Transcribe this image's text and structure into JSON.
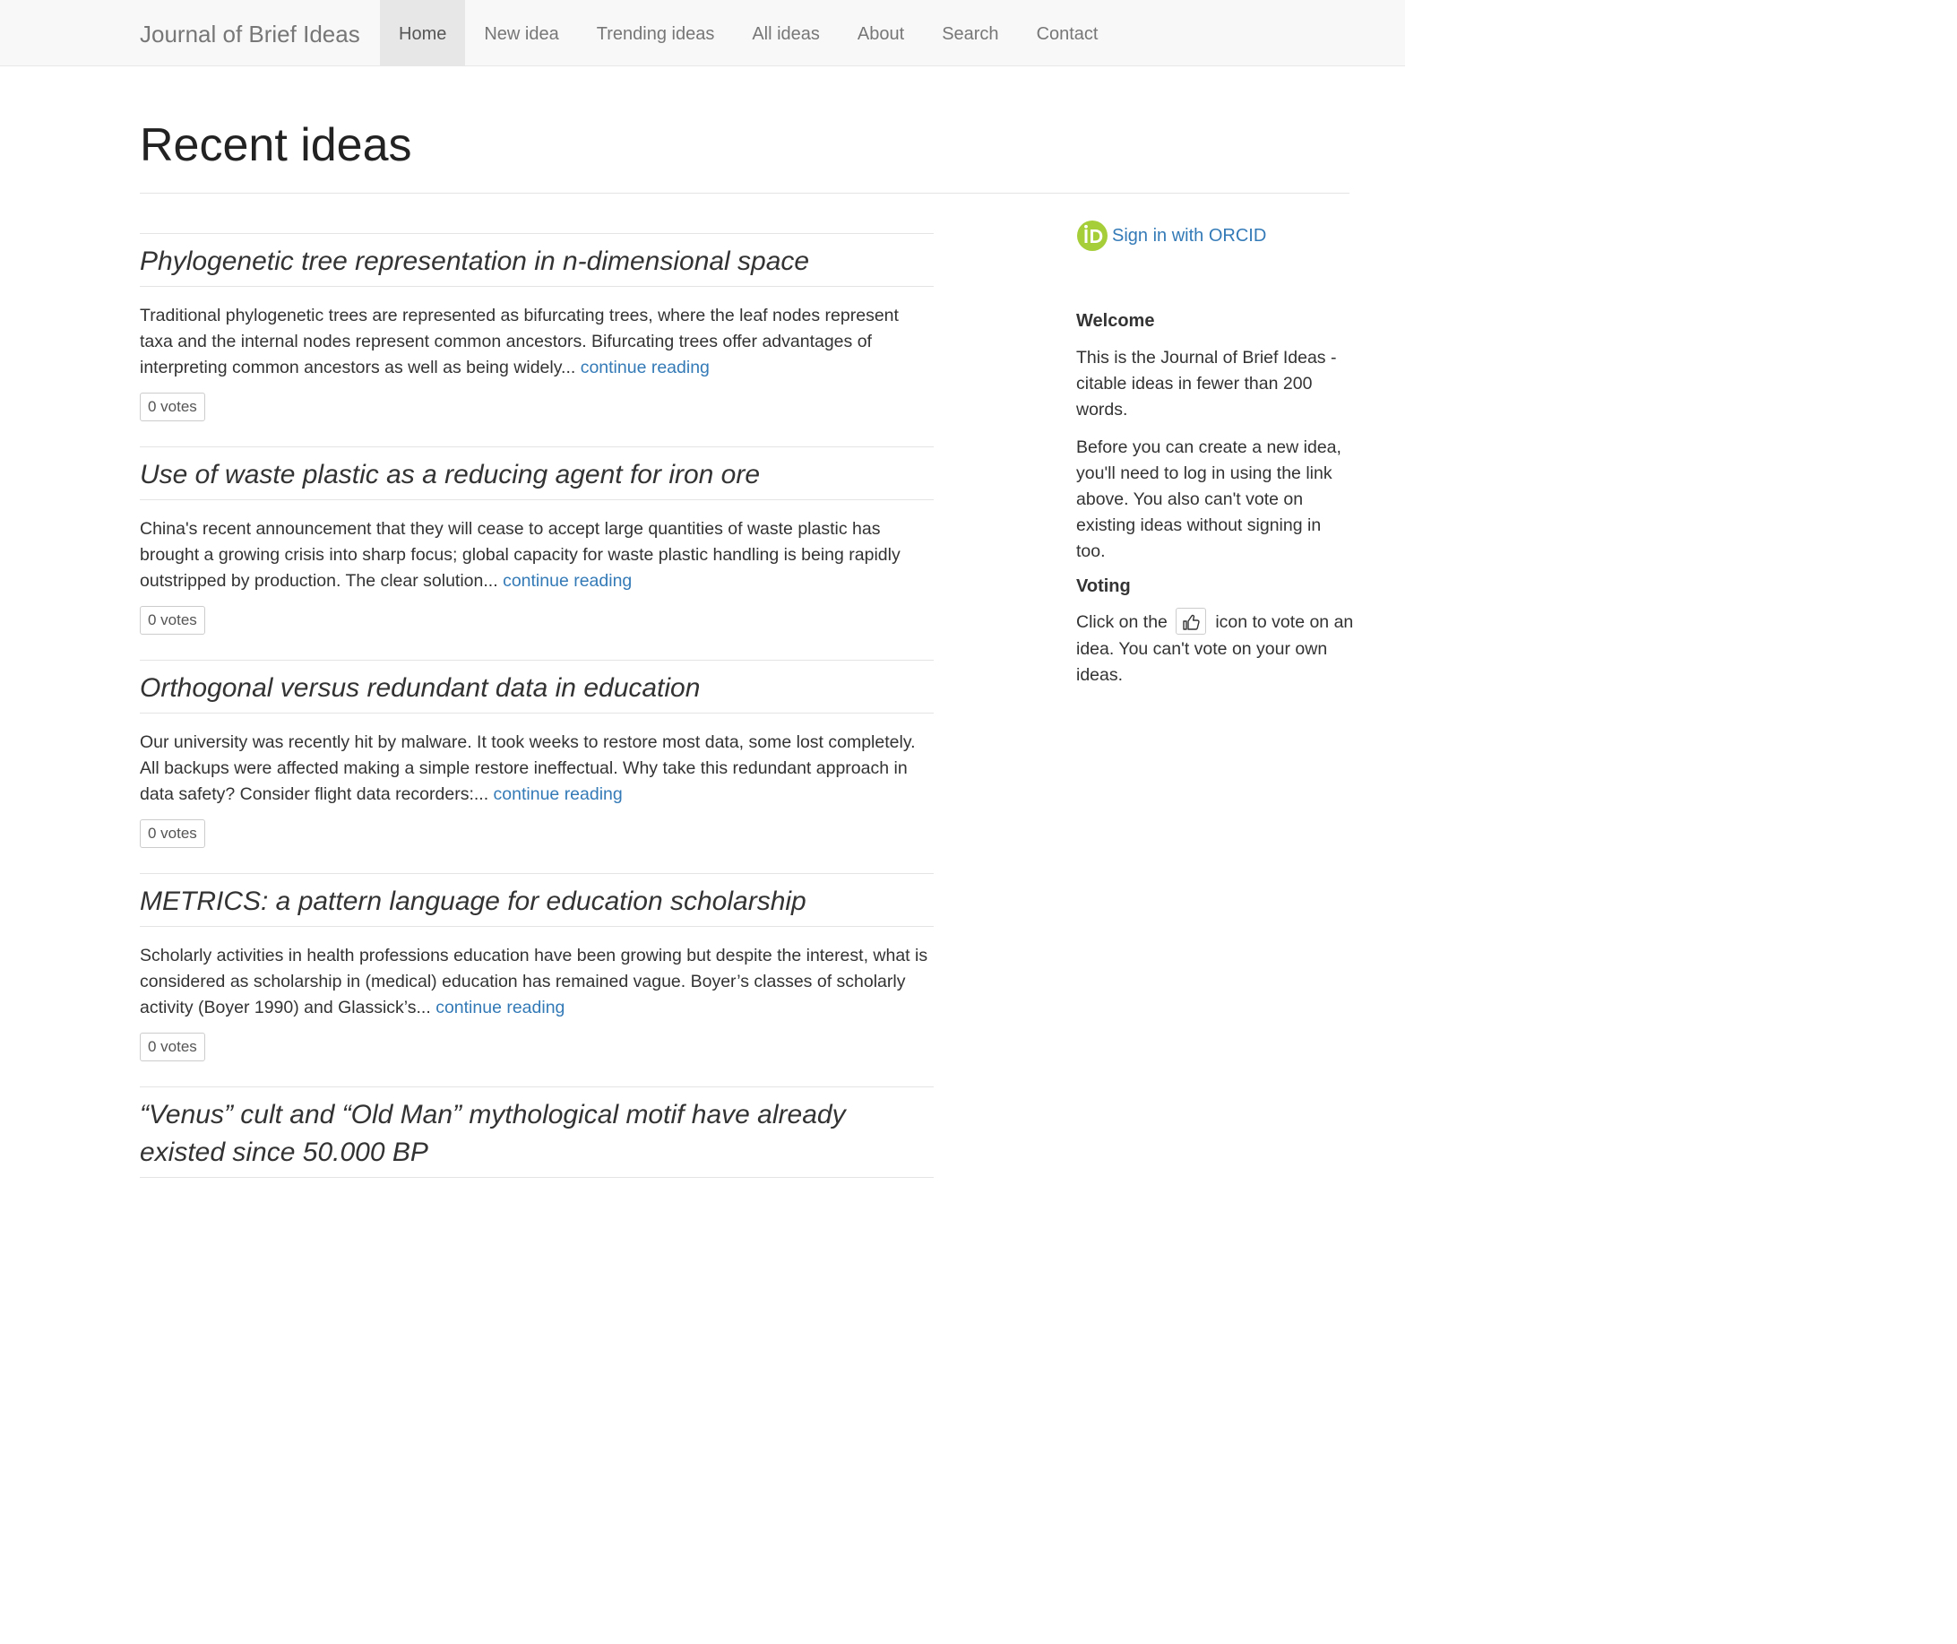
{
  "navbar": {
    "brand": "Journal of Brief Ideas",
    "items": [
      {
        "label": "Home",
        "active": true
      },
      {
        "label": "New idea",
        "active": false
      },
      {
        "label": "Trending ideas",
        "active": false
      },
      {
        "label": "All ideas",
        "active": false
      },
      {
        "label": "About",
        "active": false
      },
      {
        "label": "Search",
        "active": false
      },
      {
        "label": "Contact",
        "active": false
      }
    ]
  },
  "main": {
    "page_title": "Recent ideas",
    "ideas": [
      {
        "title": "Phylogenetic tree representation in n-dimensional space",
        "summary": "Traditional phylogenetic trees are represented as bifurcating trees, where the leaf nodes represent taxa and the internal nodes represent common ancestors. Bifurcating trees offer advantages of interpreting common ancestors as well as being widely...",
        "continue_label": "continue reading",
        "votes": "0 votes"
      },
      {
        "title": "Use of waste plastic as a reducing agent for iron ore",
        "summary": "China's recent announcement that they will cease to accept large quantities of waste plastic has brought a growing crisis into sharp focus; global capacity for waste plastic handling is being rapidly outstripped by production. The clear solution...",
        "continue_label": "continue reading",
        "votes": "0 votes"
      },
      {
        "title": "Orthogonal versus redundant data in education",
        "summary": "Our university was recently hit by malware. It took weeks to restore most data, some lost completely. All backups were affected making a simple restore ineffectual. Why take this redundant approach in data safety? Consider flight data recorders:...",
        "continue_label": "continue reading",
        "votes": "0 votes"
      },
      {
        "title": "METRICS: a pattern language for education scholarship",
        "summary": "Scholarly activities in health professions education have been growing but despite the interest, what is considered as scholarship in (medical) education has remained vague. Boyer’s classes of scholarly activity (Boyer 1990) and Glassick’s...",
        "continue_label": "continue reading",
        "votes": "0 votes"
      },
      {
        "title": "“Venus” cult and “Old Man” mythological motif have already existed since 50.000 BP"
      }
    ]
  },
  "sidebar": {
    "orcid_label": "Sign in with ORCID",
    "orcid_icon": "orcid-id-icon",
    "orcid_color": "#a6ce39",
    "welcome_heading": "Welcome",
    "welcome_text": "This is the Journal of Brief Ideas - citable ideas in fewer than 200 words.",
    "login_text": "Before you can create a new idea, you'll need to log in using the link above. You also can't vote on existing ideas without signing in too.",
    "voting_heading": "Voting",
    "voting_before": "Click on the",
    "voting_icon": "thumbs-up-icon",
    "voting_after": "icon to vote on an idea. You can't vote on your own ideas."
  },
  "colors": {
    "link": "#337ab7",
    "navbar_bg": "#f8f8f8",
    "nav_active_bg": "#e7e7e7"
  }
}
